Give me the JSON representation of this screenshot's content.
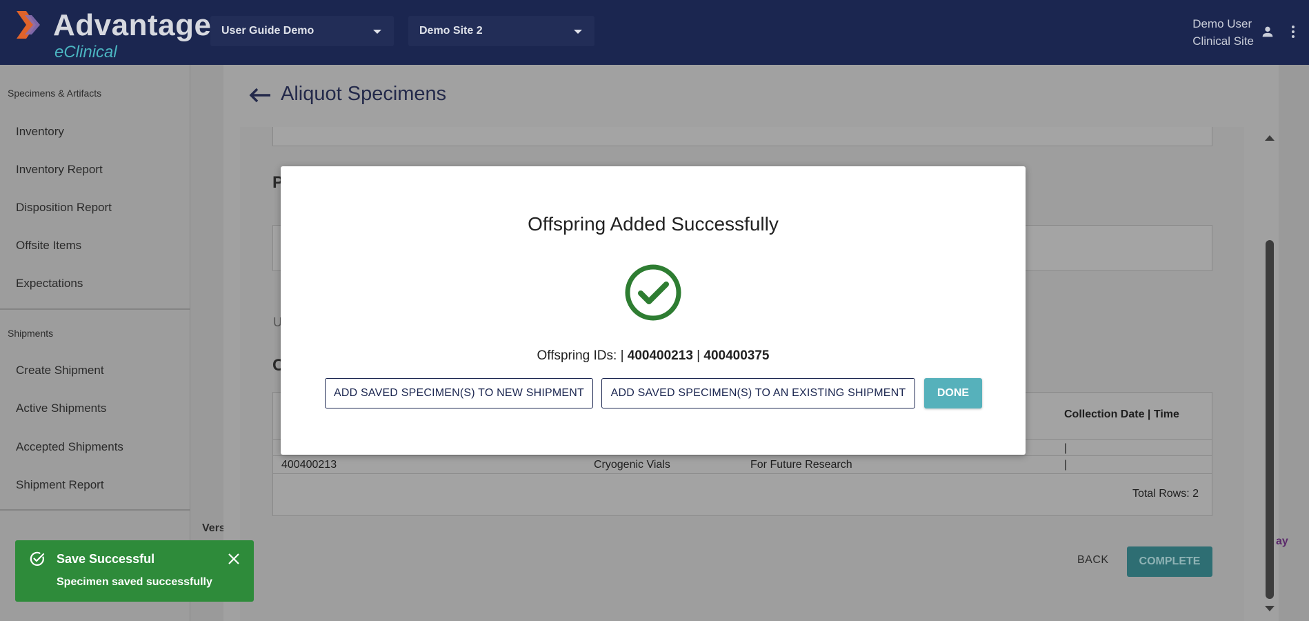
{
  "header": {
    "logo_word": "Advantage",
    "logo_sub": "eClinical",
    "study_select": "User Guide Demo",
    "site_select": "Demo Site 2",
    "user_name": "Demo User",
    "user_site": "Clinical Site"
  },
  "sidebar": {
    "sections": [
      {
        "title": "Specimens & Artifacts",
        "items": [
          "Inventory",
          "Inventory Report",
          "Disposition Report",
          "Offsite Items",
          "Expectations"
        ]
      },
      {
        "title": "Shipments",
        "items": [
          "Create Shipment",
          "Active Shipments",
          "Accepted Shipments",
          "Shipment Report"
        ]
      }
    ],
    "version_fragment": "Vers"
  },
  "page": {
    "title": "Aliquot Specimens",
    "fragment_p": "P",
    "fragment_u": "U",
    "fragment_c": "C",
    "table": {
      "header_collection": "Collection Date | Time",
      "rows": [
        {
          "id": "",
          "container": "",
          "purpose": "",
          "collection": "|"
        },
        {
          "id": "400400213",
          "container": "Cryogenic Vials",
          "purpose": "For Future Research",
          "collection": "|"
        }
      ],
      "total": "Total Rows: 2"
    },
    "back_label": "BACK",
    "complete_label": "COMPLETE",
    "edge_fragment": "ay"
  },
  "modal": {
    "title": "Offspring Added Successfully",
    "ids_prefix": "Offspring IDs: |",
    "id1": "400400213",
    "separator": "|",
    "id2": "400400375",
    "btn_new_shipment": "ADD SAVED SPECIMEN(S) TO NEW SHIPMENT",
    "btn_existing_shipment": "ADD SAVED SPECIMEN(S) TO AN EXISTING SHIPMENT",
    "btn_done": "DONE",
    "success_color": "#2e7d32"
  },
  "toast": {
    "title": "Save Successful",
    "message": "Specimen saved successfully",
    "color": "#2e8b3a"
  }
}
